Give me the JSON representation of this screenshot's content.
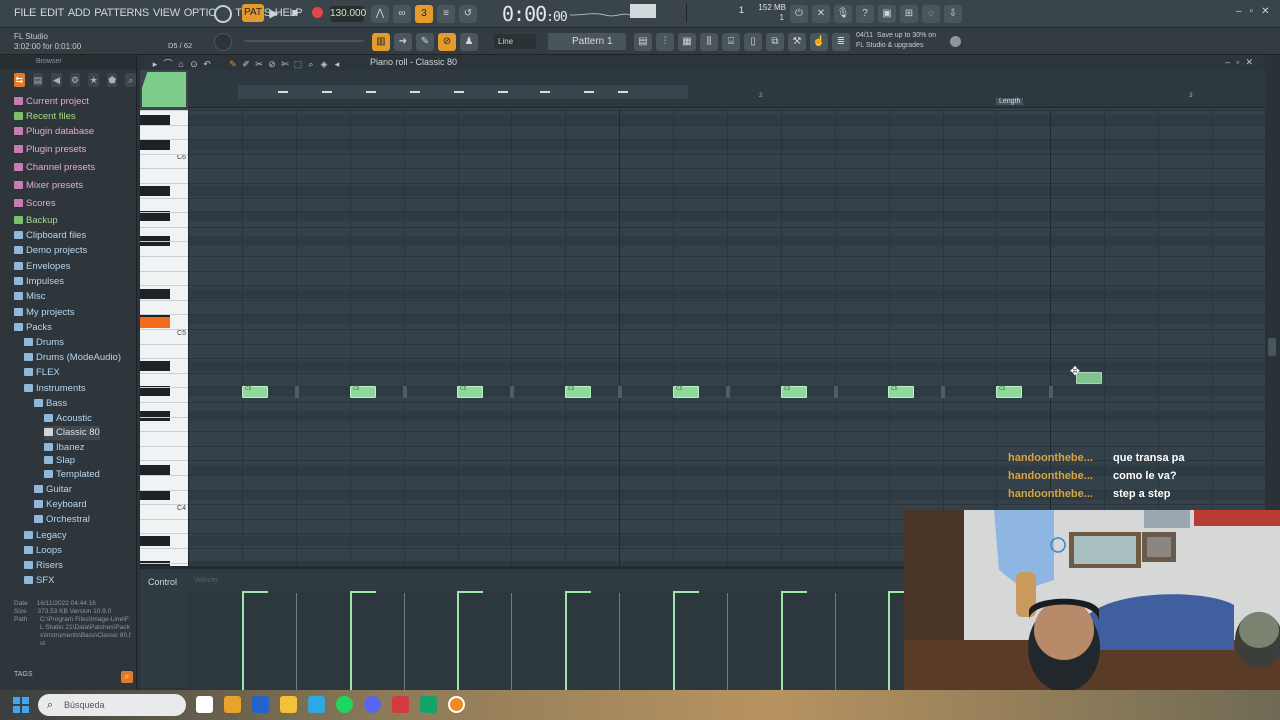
{
  "menu": [
    "FILE",
    "EDIT",
    "ADD",
    "PATTERNS",
    "VIEW",
    "OPTIONS",
    "TOOLS",
    "HELP"
  ],
  "transport": {
    "bpm": "130.000",
    "time": "0:00",
    "time_small": ":00"
  },
  "cpu": {
    "mem": "152 MB",
    "voices": "1",
    "poly": "1"
  },
  "hint": {
    "app": "FL Studio",
    "time_line": "3:02:00 for 0:01:00",
    "pos": "D5 / 62"
  },
  "snap": "Line",
  "pattern": "Pattern 1",
  "news": {
    "date": "04/11",
    "line1": "Save up to 30% on",
    "line2": "FL Studio & upgrades"
  },
  "browser": {
    "header": "Browser",
    "tree": [
      {
        "label": "Current project",
        "color": "pink",
        "indent": 1
      },
      {
        "label": "Recent files",
        "color": "green",
        "indent": 1
      },
      {
        "label": "Plugin database",
        "color": "pink",
        "indent": 1
      },
      {
        "label": "Plugin presets",
        "color": "pink",
        "indent": 1
      },
      {
        "label": "Channel presets",
        "color": "pink",
        "indent": 1
      },
      {
        "label": "Mixer presets",
        "color": "pink",
        "indent": 1
      },
      {
        "label": "Scores",
        "color": "pink",
        "indent": 1
      },
      {
        "label": "Backup",
        "color": "green",
        "indent": 1
      },
      {
        "label": "Clipboard files",
        "color": "blue",
        "indent": 1
      },
      {
        "label": "Demo projects",
        "color": "blue",
        "indent": 1
      },
      {
        "label": "Envelopes",
        "color": "blue",
        "indent": 1
      },
      {
        "label": "Impulses",
        "color": "blue",
        "indent": 1
      },
      {
        "label": "Misc",
        "color": "blue",
        "indent": 1
      },
      {
        "label": "My projects",
        "color": "blue",
        "indent": 1
      },
      {
        "label": "Packs",
        "color": "blue",
        "indent": 1
      },
      {
        "label": "Drums",
        "color": "blue",
        "indent": 2
      },
      {
        "label": "Drums (ModeAudio)",
        "color": "blue",
        "indent": 2
      },
      {
        "label": "FLEX",
        "color": "blue",
        "indent": 2
      },
      {
        "label": "Instruments",
        "color": "blue",
        "indent": 2
      },
      {
        "label": "Bass",
        "color": "blue",
        "indent": 3
      },
      {
        "label": "Acoustic",
        "color": "blue",
        "indent": 4
      },
      {
        "label": "Classic 80",
        "color": "white",
        "indent": 4
      },
      {
        "label": "Ibanez",
        "color": "blue",
        "indent": 4
      },
      {
        "label": "Slap",
        "color": "blue",
        "indent": 4
      },
      {
        "label": "Templated",
        "color": "blue",
        "indent": 4
      },
      {
        "label": "Guitar",
        "color": "blue",
        "indent": 3
      },
      {
        "label": "Keyboard",
        "color": "blue",
        "indent": 3
      },
      {
        "label": "Orchestral",
        "color": "blue",
        "indent": 3
      },
      {
        "label": "Legacy",
        "color": "blue",
        "indent": 2
      },
      {
        "label": "Loops",
        "color": "blue",
        "indent": 2
      },
      {
        "label": "Risers",
        "color": "blue",
        "indent": 2
      },
      {
        "label": "SFX",
        "color": "blue",
        "indent": 2
      }
    ],
    "info": {
      "date_lbl": "Date",
      "date": "16/11/2022 04:44:16",
      "size_lbl": "Size",
      "size": "373.53 KB   Version 10.9.0",
      "path_lbl": "Path",
      "path": "C:\\Program Files\\Image-Line\\FL Studio 21\\Data\\Patches\\Packs\\Instruments\\Bass\\Classic 80.fst"
    },
    "tags": "TAGS"
  },
  "piano_roll": {
    "title": "Piano roll - Classic 80",
    "ruler": [
      "2",
      "3"
    ],
    "length_label": "Length",
    "key_labels": [
      "C6",
      "C5",
      "C4"
    ],
    "note_label": "C5",
    "control_label": "Control",
    "control_sub": "Velocity"
  },
  "chat": [
    {
      "user": "handoonthebe...",
      "msg": "que transa pa"
    },
    {
      "user": "handoonthebe...",
      "msg": "como le va?"
    },
    {
      "user": "handoonthebe...",
      "msg": "step a step"
    }
  ],
  "taskbar": {
    "search": "Búsqueda"
  }
}
